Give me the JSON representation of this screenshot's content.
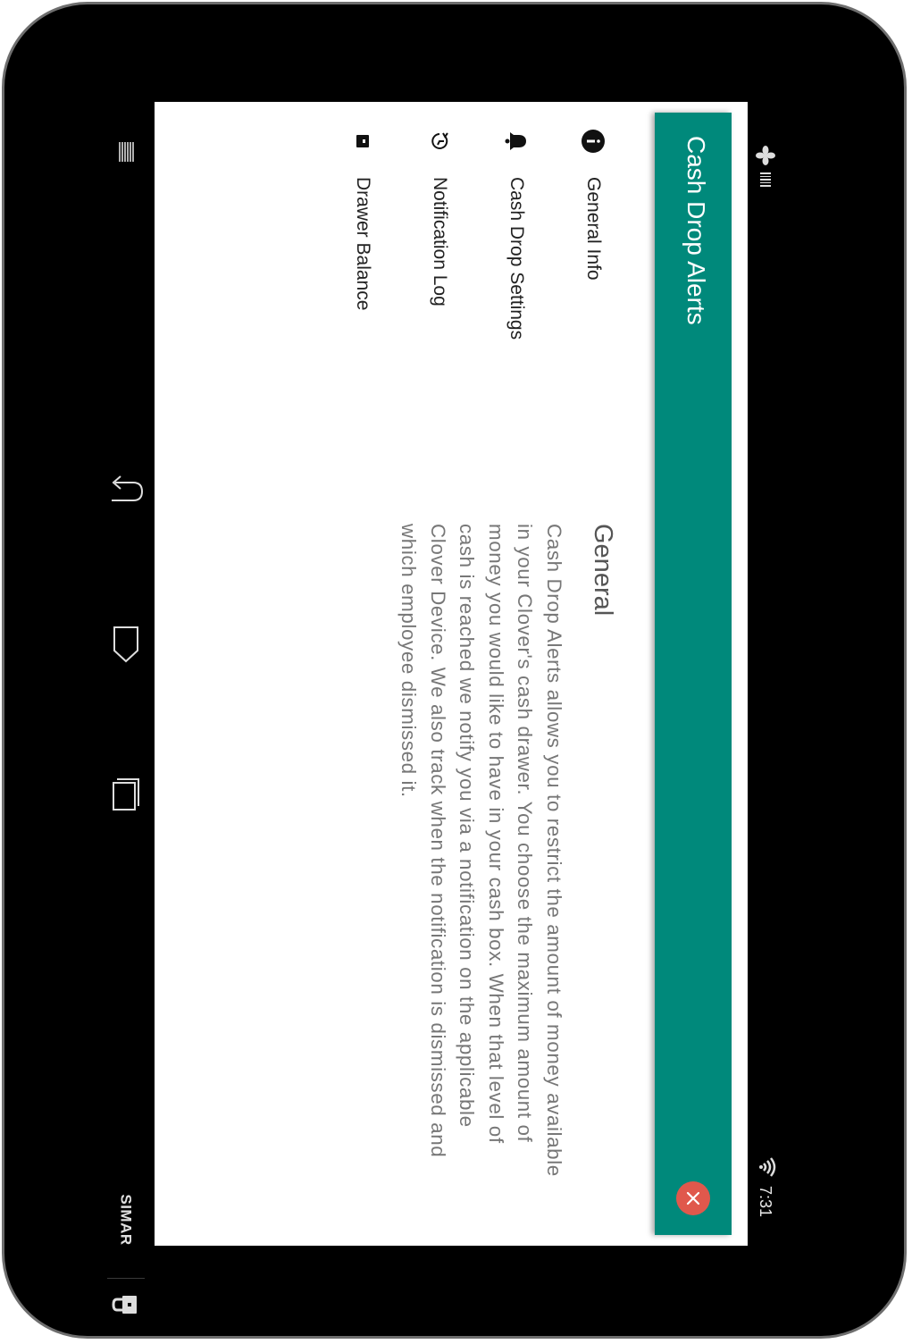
{
  "status_bar": {
    "time": "7:31"
  },
  "toolbar": {
    "title": "Cash Drop Alerts"
  },
  "sidebar": {
    "items": [
      {
        "label": "General Info",
        "icon": "info-icon"
      },
      {
        "label": "Cash Drop Settings",
        "icon": "bell-icon"
      },
      {
        "label": "Notification Log",
        "icon": "history-icon"
      },
      {
        "label": "Drawer Balance",
        "icon": "drawer-icon"
      }
    ]
  },
  "content": {
    "section_title": "General",
    "body": "Cash Drop Alerts allows you to restrict the amount of money available in your Clover's cash drawer. You choose the maximum amount of money you would like to have in your cash box. When that level of cash is reached we notify you via a notification on the applicable Clover Device. We also track when the notification is dismissed and which employee dismissed it."
  },
  "system_nav": {
    "user_label": "SIMAR"
  },
  "colors": {
    "toolbar": "#00897b",
    "close_button": "#e0584c",
    "device_frame": "#000000"
  }
}
